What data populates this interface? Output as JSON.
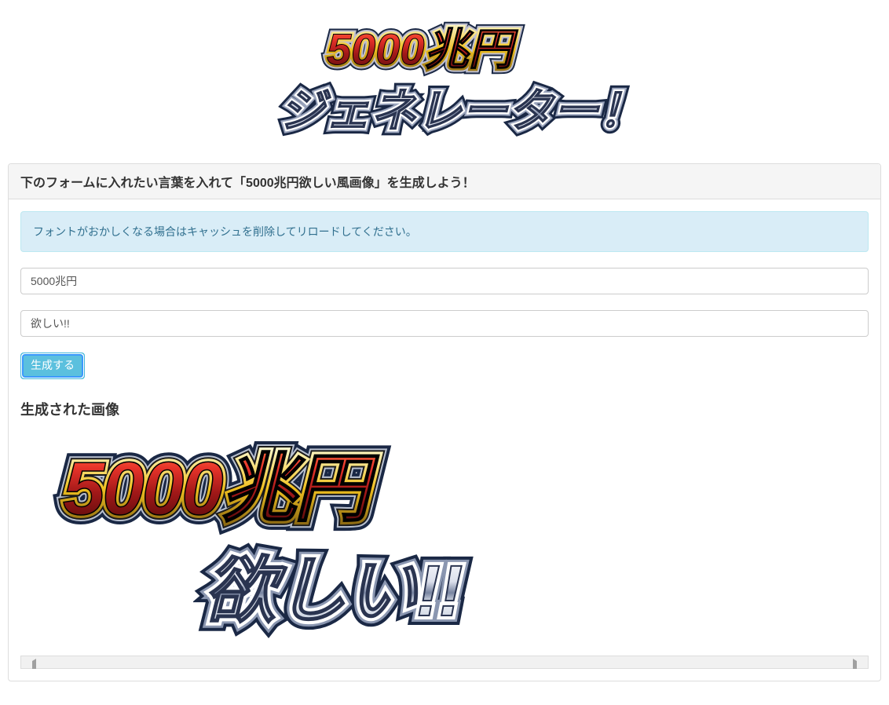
{
  "header": {
    "logo_line1": "5000兆円",
    "logo_line2": "ジェネレーター！"
  },
  "panel": {
    "heading": "下のフォームに入れたい言葉を入れて「5000兆円欲しい風画像」を生成しよう！",
    "alert": "フォントがおかしくなる場合はキャッシュを削除してリロードしてください。",
    "input1_value": "5000兆円",
    "input2_value": "欲しい!!",
    "generate_button": "生成する",
    "result_heading": "生成された画像",
    "result_line1": "5000兆円",
    "result_line2": "欲しい!!"
  }
}
